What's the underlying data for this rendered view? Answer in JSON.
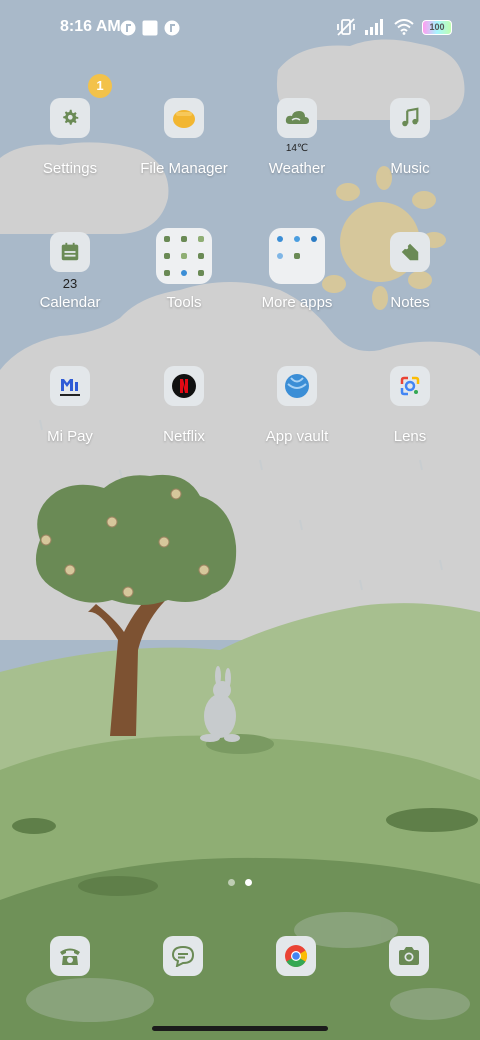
{
  "status_bar": {
    "time": "8:16 AM",
    "battery": "100"
  },
  "apps": [
    {
      "id": "settings",
      "label": "Settings",
      "badge": "1"
    },
    {
      "id": "file-manager",
      "label": "File Manager"
    },
    {
      "id": "weather",
      "label": "Weather",
      "sub": "14℃"
    },
    {
      "id": "music",
      "label": "Music"
    },
    {
      "id": "calendar",
      "label": "Calendar",
      "sub": "23"
    },
    {
      "id": "tools",
      "label": "Tools"
    },
    {
      "id": "more-apps",
      "label": "More apps"
    },
    {
      "id": "notes",
      "label": "Notes"
    },
    {
      "id": "mi-pay",
      "label": "Mi Pay"
    },
    {
      "id": "netflix",
      "label": "Netflix"
    },
    {
      "id": "app-vault",
      "label": "App vault"
    },
    {
      "id": "lens",
      "label": "Lens"
    }
  ],
  "page_indicator": {
    "total": 2,
    "active": 2
  },
  "colors": {
    "sky": "#a9b9c9",
    "cloud": "#d0d0d0",
    "hill_light": "#a7bf8f",
    "hill_dark": "#6f9158",
    "accent_badge": "#f3c24a",
    "icon_green": "#6a8a55"
  },
  "dock": [
    {
      "id": "phone",
      "icon": "phone-icon"
    },
    {
      "id": "messages",
      "icon": "message-icon"
    },
    {
      "id": "chrome",
      "icon": "chrome-icon"
    },
    {
      "id": "camera",
      "icon": "camera-icon"
    }
  ]
}
